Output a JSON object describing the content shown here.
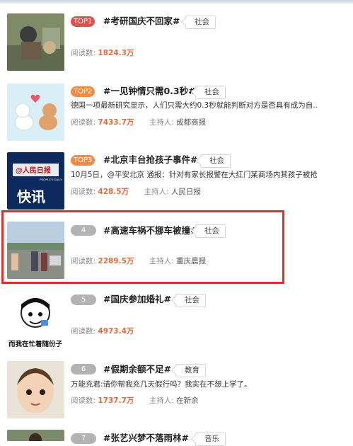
{
  "colors": {
    "top1": "#e0514f",
    "top23": "#f08b46",
    "normal_rank": "#b3b3b3",
    "count": "#e06b3e",
    "highlight": "#e02d2d"
  },
  "labels": {
    "read": "阅读数:",
    "host": "主持人:"
  },
  "items": [
    {
      "rank": "TOP1",
      "title": "#考研国庆不回家#",
      "tag": "社会",
      "desc": "",
      "reads": "1824.3万",
      "host": ""
    },
    {
      "rank": "TOP2",
      "title": "#一见钟情只需0.3秒#",
      "tag": "社会",
      "desc": "德国一项最新研究显示，人们只需大约0.3秒就能判断对方是否具有成为自...",
      "reads": "7433.7万",
      "host": "成都商报"
    },
    {
      "rank": "TOP3",
      "title": "#北京丰台抢孩子事件#",
      "tag": "社会",
      "desc": "10月5日，@平安北京 通报：针对有家长报警在大红门某商场内其孩子被抢...",
      "reads": "428.5万",
      "host": "人民日报"
    },
    {
      "rank": "4",
      "title": "#高速车祸不挪车被撞#",
      "tag": "社会",
      "desc": "",
      "reads": "2289.5万",
      "host": "重庆晨报"
    },
    {
      "rank": "5",
      "title": "#国庆参加婚礼#",
      "tag": "社会",
      "desc": "",
      "reads": "4973.4万",
      "host": ""
    },
    {
      "rank": "6",
      "title": "#假期余额不足#",
      "tag": "教育",
      "desc": "万能充君:请你帮我充几天假行吗？我实在不想上学了。",
      "reads": "1737.7万",
      "host": "在新余"
    },
    {
      "rank": "7",
      "title": "#张艺兴梦不落雨林#",
      "tag": "音乐",
      "desc": "",
      "reads": "",
      "host": ""
    }
  ],
  "thumbs": {
    "news_logo": "@人民日报",
    "news_logo_sub": "PEOPLE'S DAILY",
    "news_flash": "快讯",
    "meme_caption": "而我在忙着随份子"
  }
}
